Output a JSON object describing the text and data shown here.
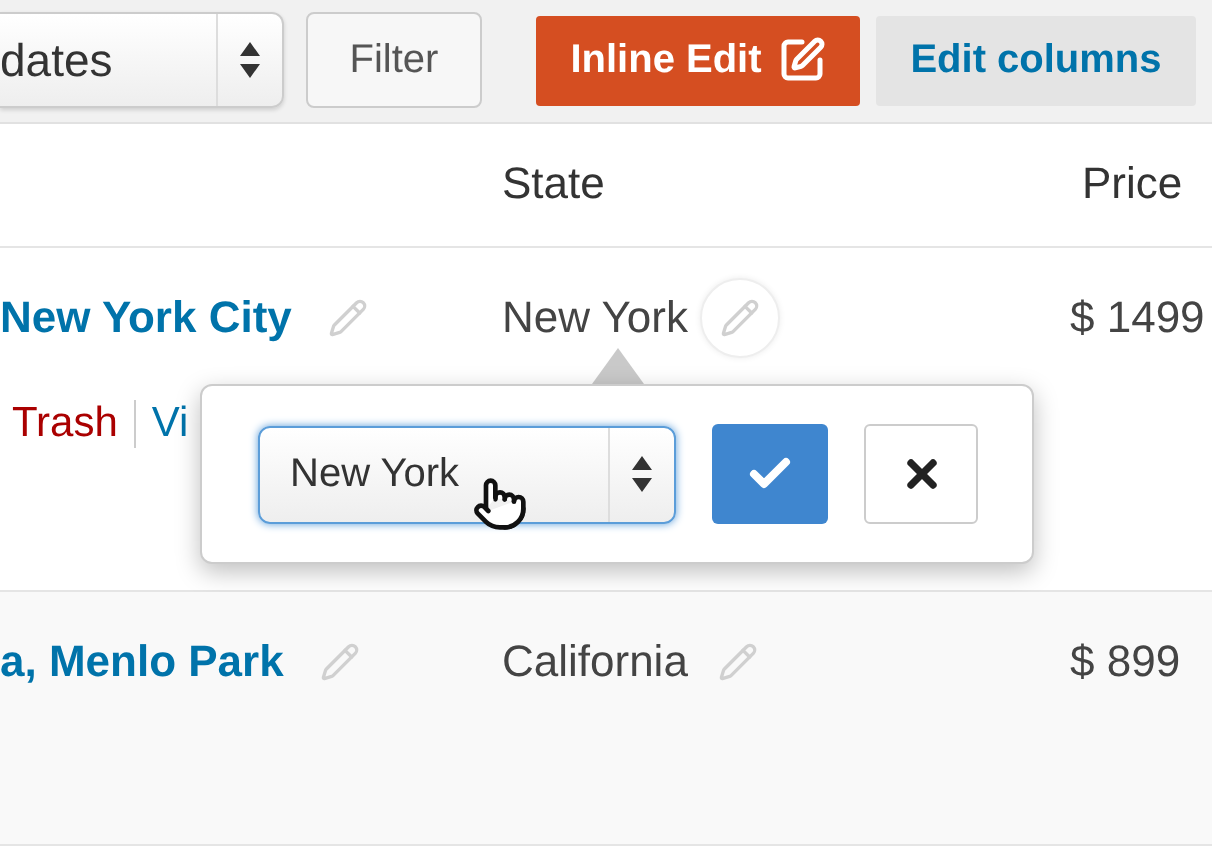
{
  "toolbar": {
    "date_select": {
      "value": "dates"
    },
    "filter_button": "Filter",
    "inline_edit_button": "Inline Edit",
    "edit_columns_button": "Edit columns"
  },
  "table": {
    "columns": [
      "State",
      "Price"
    ],
    "rows": [
      {
        "title": "New York City",
        "state": "New York",
        "price": "$ 1499",
        "editing": true,
        "actions": [
          {
            "label": "Trash",
            "kind": "delete"
          },
          {
            "label": "Vi",
            "kind": "view"
          }
        ]
      },
      {
        "title": "a, Menlo Park",
        "state": "California",
        "price": "$ 899",
        "editing": false
      }
    ]
  },
  "popover": {
    "value": "New York"
  }
}
